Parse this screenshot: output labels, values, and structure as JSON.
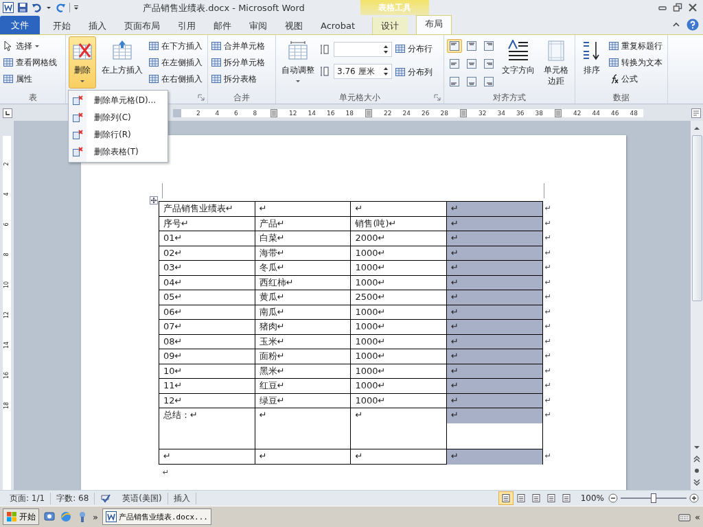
{
  "title_bar": {
    "title": "产品销售业绩表.docx  -  Microsoft Word",
    "context_label": "表格工具"
  },
  "tabs": [
    {
      "label": "文件",
      "kind": "file",
      "selected": false
    },
    {
      "label": "开始",
      "kind": "normal",
      "selected": false
    },
    {
      "label": "插入",
      "kind": "normal",
      "selected": false
    },
    {
      "label": "页面布局",
      "kind": "normal",
      "selected": false
    },
    {
      "label": "引用",
      "kind": "normal",
      "selected": false
    },
    {
      "label": "邮件",
      "kind": "normal",
      "selected": false
    },
    {
      "label": "审阅",
      "kind": "normal",
      "selected": false
    },
    {
      "label": "视图",
      "kind": "normal",
      "selected": false
    },
    {
      "label": "Acrobat",
      "kind": "normal",
      "selected": false
    },
    {
      "label": "设计",
      "kind": "context",
      "selected": false
    },
    {
      "label": "布局",
      "kind": "context",
      "selected": true
    }
  ],
  "ribbon": {
    "groups": [
      {
        "label": "表",
        "items": [
          {
            "kind": "small",
            "label": "选择",
            "dropdown": true
          },
          {
            "kind": "small",
            "label": "查看网格线"
          },
          {
            "kind": "small",
            "label": "属性"
          }
        ]
      },
      {
        "launcher": true,
        "items": [
          {
            "kind": "large",
            "label": "删除",
            "dropdown": true,
            "pressed": true
          },
          {
            "kind": "large",
            "label": "在上方插入",
            "pressed": false
          },
          {
            "kind": "small",
            "label": "在下方插入"
          },
          {
            "kind": "small",
            "label": "在左侧插入"
          },
          {
            "kind": "small",
            "label": "在右侧插入"
          }
        ]
      },
      {
        "label": "合并",
        "items": [
          {
            "kind": "small",
            "label": "合并单元格"
          },
          {
            "kind": "small",
            "label": "拆分单元格"
          },
          {
            "kind": "small",
            "label": "拆分表格"
          }
        ]
      },
      {
        "label": "单元格大小",
        "launcher": true,
        "items": [
          {
            "kind": "large",
            "label": "自动调整",
            "dropdown": true,
            "pressed": false
          },
          {
            "kind": "spinner"
          },
          {
            "kind": "spinner",
            "value": "3.76 厘米"
          },
          {
            "kind": "small",
            "label": "分布行"
          },
          {
            "kind": "small",
            "label": "分布列"
          }
        ]
      },
      {
        "label": "对齐方式",
        "items": [
          {
            "kind": "align_grid",
            "cells": [
              {
                "selected": true
              },
              {
                "selected": false
              },
              {
                "selected": false
              },
              {
                "selected": false
              },
              {
                "selected": false
              },
              {
                "selected": false
              },
              {
                "selected": false
              },
              {
                "selected": false
              },
              {
                "selected": false
              }
            ]
          },
          {
            "kind": "large",
            "label": "文字方向",
            "pressed": false
          },
          {
            "kind": "large",
            "label": "单元格边距",
            "pressed": false
          }
        ]
      },
      {
        "label": "数据",
        "items": [
          {
            "kind": "large",
            "label": "排序",
            "pressed": false
          },
          {
            "kind": "small",
            "label": "重复标题行"
          },
          {
            "kind": "small",
            "label": "转换为文本"
          },
          {
            "kind": "small",
            "label": "公式"
          }
        ]
      }
    ]
  },
  "delete_menu": [
    {
      "label": "删除单元格(D)..."
    },
    {
      "label": "删除列(C)"
    },
    {
      "label": "删除行(R)"
    },
    {
      "label": "删除表格(T)"
    }
  ],
  "ruler": {
    "groups": [
      [
        "2",
        "4",
        "6",
        "8"
      ],
      [
        "12",
        "14",
        "16",
        "18"
      ],
      [
        "22",
        "24",
        "26",
        "28"
      ],
      [
        "32",
        "34",
        "36",
        "38"
      ],
      [
        "42",
        "44",
        "46",
        "48"
      ]
    ],
    "vertical": [
      "2",
      "4",
      "6",
      "8",
      "10",
      "12",
      "14",
      "16",
      "18"
    ]
  },
  "table": {
    "rows": [
      {
        "kind": "normal",
        "end_mark": "↵",
        "cells": [
          {
            "text": "产品销售业绩表↵",
            "selected": false
          },
          {
            "text": "↵",
            "selected": false
          },
          {
            "text": "↵",
            "selected": false
          },
          {
            "text": "↵",
            "selected": true
          }
        ]
      },
      {
        "kind": "normal",
        "end_mark": "↵",
        "cells": [
          {
            "text": "序号↵",
            "selected": false
          },
          {
            "text": "产品↵",
            "selected": false
          },
          {
            "text": "销售(吨)↵",
            "selected": false
          },
          {
            "text": "↵",
            "selected": true
          }
        ]
      },
      {
        "kind": "normal",
        "end_mark": "↵",
        "cells": [
          {
            "text": "01↵",
            "selected": false
          },
          {
            "text": "白菜↵",
            "selected": false
          },
          {
            "text": "2000↵",
            "selected": false
          },
          {
            "text": "↵",
            "selected": true
          }
        ]
      },
      {
        "kind": "normal",
        "end_mark": "↵",
        "cells": [
          {
            "text": "02↵",
            "selected": false
          },
          {
            "text": "海带↵",
            "selected": false
          },
          {
            "text": "1000↵",
            "selected": false
          },
          {
            "text": "↵",
            "selected": true
          }
        ]
      },
      {
        "kind": "normal",
        "end_mark": "↵",
        "cells": [
          {
            "text": "03↵",
            "selected": false
          },
          {
            "text": "冬瓜↵",
            "selected": false
          },
          {
            "text": "1000↵",
            "selected": false
          },
          {
            "text": "↵",
            "selected": true
          }
        ]
      },
      {
        "kind": "normal",
        "end_mark": "↵",
        "cells": [
          {
            "text": "04↵",
            "selected": false
          },
          {
            "text": "西红柿↵",
            "selected": false
          },
          {
            "text": "1000↵",
            "selected": false
          },
          {
            "text": "↵",
            "selected": true
          }
        ]
      },
      {
        "kind": "normal",
        "end_mark": "↵",
        "cells": [
          {
            "text": "05↵",
            "selected": false
          },
          {
            "text": "黄瓜↵",
            "selected": false
          },
          {
            "text": "2500↵",
            "selected": false
          },
          {
            "text": "↵",
            "selected": true
          }
        ]
      },
      {
        "kind": "normal",
        "end_mark": "↵",
        "cells": [
          {
            "text": "06↵",
            "selected": false
          },
          {
            "text": "南瓜↵",
            "selected": false
          },
          {
            "text": "1000↵",
            "selected": false
          },
          {
            "text": "↵",
            "selected": true
          }
        ]
      },
      {
        "kind": "normal",
        "end_mark": "↵",
        "cells": [
          {
            "text": "07↵",
            "selected": false
          },
          {
            "text": "猪肉↵",
            "selected": false
          },
          {
            "text": "1000↵",
            "selected": false
          },
          {
            "text": "↵",
            "selected": true
          }
        ]
      },
      {
        "kind": "normal",
        "end_mark": "↵",
        "cells": [
          {
            "text": "08↵",
            "selected": false
          },
          {
            "text": "玉米↵",
            "selected": false
          },
          {
            "text": "1000↵",
            "selected": false
          },
          {
            "text": "↵",
            "selected": true
          }
        ]
      },
      {
        "kind": "normal",
        "end_mark": "↵",
        "cells": [
          {
            "text": "09↵",
            "selected": false
          },
          {
            "text": "面粉↵",
            "selected": false
          },
          {
            "text": "1000↵",
            "selected": false
          },
          {
            "text": "↵",
            "selected": true
          }
        ]
      },
      {
        "kind": "normal",
        "end_mark": "↵",
        "cells": [
          {
            "text": "10↵",
            "selected": false
          },
          {
            "text": "黑米↵",
            "selected": false
          },
          {
            "text": "1000↵",
            "selected": false
          },
          {
            "text": "↵",
            "selected": true
          }
        ]
      },
      {
        "kind": "normal",
        "end_mark": "↵",
        "cells": [
          {
            "text": "11↵",
            "selected": false
          },
          {
            "text": "红豆↵",
            "selected": false
          },
          {
            "text": "1000↵",
            "selected": false
          },
          {
            "text": "↵",
            "selected": true
          }
        ]
      },
      {
        "kind": "normal",
        "end_mark": "↵",
        "cells": [
          {
            "text": "12↵",
            "selected": false
          },
          {
            "text": "绿豆↵",
            "selected": false
          },
          {
            "text": "1000↵",
            "selected": false
          },
          {
            "text": "↵",
            "selected": true
          }
        ]
      },
      {
        "kind": "tall",
        "end_mark": "↵",
        "cells": [
          {
            "text": "总结：↵",
            "selected": false
          },
          {
            "text": "↵",
            "selected": false
          },
          {
            "text": "↵",
            "selected": false
          },
          {
            "text": "↵",
            "selected": true
          }
        ]
      },
      {
        "kind": "normal",
        "end_mark": "↵",
        "cells": [
          {
            "text": "↵",
            "selected": false
          },
          {
            "text": "↵",
            "selected": false
          },
          {
            "text": "↵",
            "selected": false
          },
          {
            "text": "↵",
            "selected": true
          }
        ]
      }
    ],
    "after_mark": "↵"
  },
  "status_bar": {
    "page": "页面: 1/1",
    "words": "字数: 68",
    "language": "英语(美国)",
    "mode": "插入",
    "views": [
      {
        "selected": true
      },
      {
        "selected": false
      },
      {
        "selected": false
      },
      {
        "selected": false
      },
      {
        "selected": false
      }
    ],
    "zoom": "100%",
    "zoom_slider": {
      "level": 0.5
    }
  },
  "taskbar": {
    "start": "开始",
    "overflow": "»",
    "window": "产品销售业绩表.docx...",
    "tray_toggle": "«"
  }
}
